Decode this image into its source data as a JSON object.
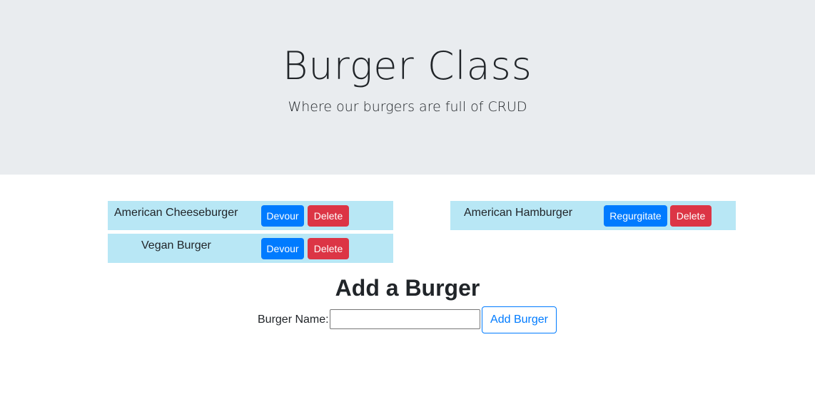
{
  "header": {
    "title": "Burger Class",
    "subtitle": "Where our burgers are full of CRUD"
  },
  "not_devoured": [
    {
      "name": "American Cheeseburger",
      "devour_label": "Devour",
      "delete_label": "Delete"
    },
    {
      "name": "Vegan Burger",
      "devour_label": "Devour",
      "delete_label": "Delete"
    }
  ],
  "devoured": [
    {
      "name": "American Hamburger",
      "regurgitate_label": "Regurgitate",
      "delete_label": "Delete"
    }
  ],
  "add_form": {
    "title": "Add a Burger",
    "label": "Burger Name:",
    "input_value": "",
    "submit_label": "Add Burger"
  },
  "colors": {
    "jumbotron_bg": "#e9ecef",
    "row_bg": "#b8e7f5",
    "primary": "#007bff",
    "danger": "#dc3545"
  }
}
